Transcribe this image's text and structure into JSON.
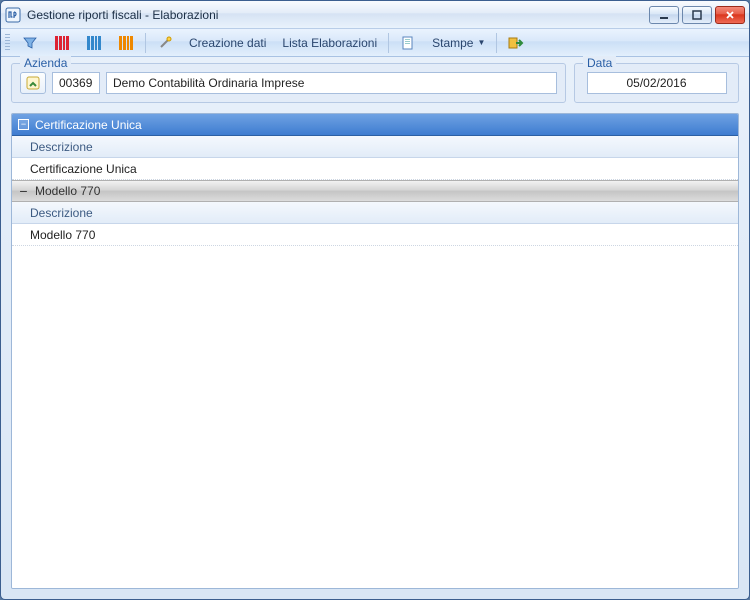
{
  "window": {
    "title": "Gestione riporti fiscali - Elaborazioni"
  },
  "toolbar": {
    "creazione_dati": "Creazione dati",
    "lista_elaborazioni": "Lista Elaborazioni",
    "stampe": "Stampe"
  },
  "azienda": {
    "legend": "Azienda",
    "code": "00369",
    "name": "Demo Contabilità Ordinaria Imprese"
  },
  "data": {
    "legend": "Data",
    "value": "05/02/2016"
  },
  "groups": [
    {
      "title": "Certificazione Unica",
      "column_label": "Descrizione",
      "rows": [
        "Certificazione Unica"
      ],
      "expanded": true,
      "active": true
    },
    {
      "title": "Modello 770",
      "column_label": "Descrizione",
      "rows": [
        "Modello 770"
      ],
      "expanded": true,
      "active": false
    }
  ]
}
